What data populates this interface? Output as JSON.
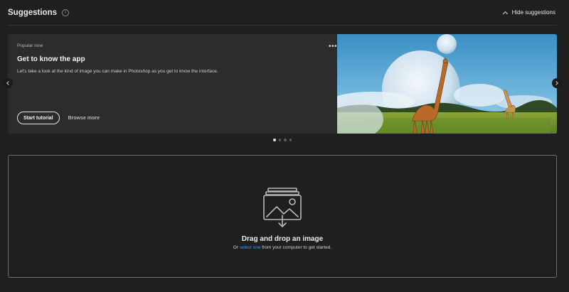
{
  "header": {
    "title": "Suggestions",
    "info_icon": "info-icon",
    "hide_label": "Hide suggestions"
  },
  "carousel": {
    "eyebrow": "Popular now",
    "title": "Get to know the app",
    "description": "Let's take a look at the kind of image you can make in Photoshop as you get to know the interface.",
    "start_label": "Start tutorial",
    "browse_label": "Browse more",
    "more_label": "•••",
    "image": "giraffes-moon-landscape",
    "dots": {
      "count": 4,
      "active_index": 0
    }
  },
  "dropzone": {
    "title": "Drag and drop an image",
    "sub_prefix": "Or ",
    "sub_link": "select one",
    "sub_suffix": " from your computer to get started."
  },
  "colors": {
    "background": "#1f1f1f",
    "card": "#2c2c2c",
    "link": "#3f97ff"
  }
}
